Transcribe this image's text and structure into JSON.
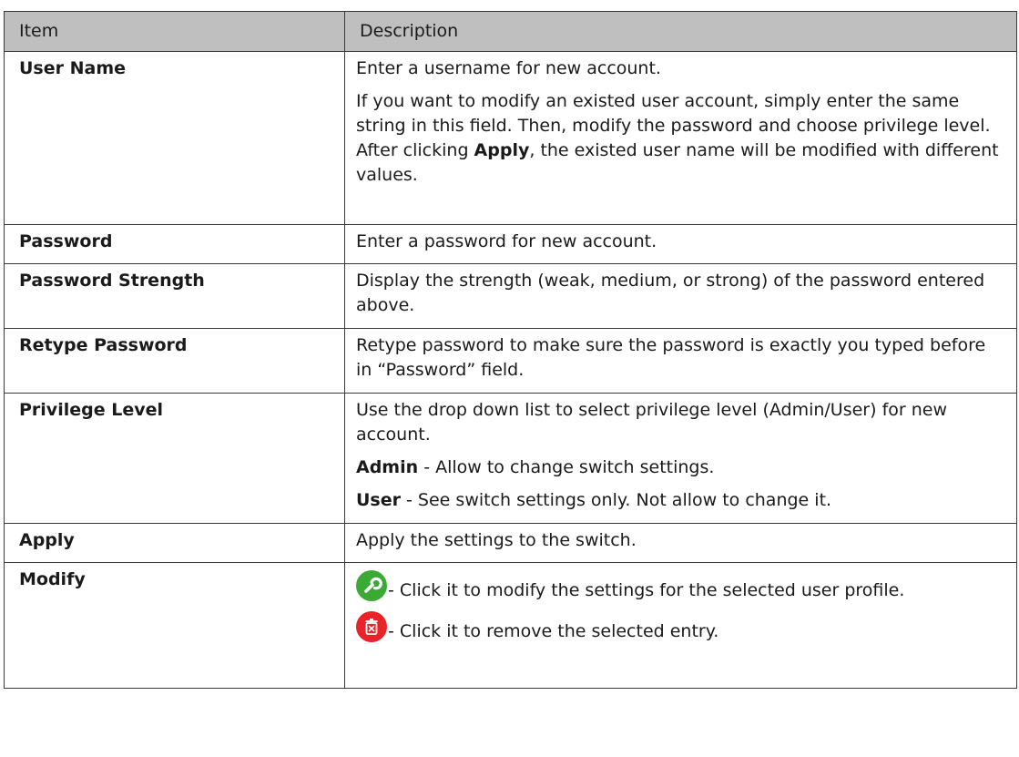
{
  "header": {
    "item": "Item",
    "description": "Description"
  },
  "rows": [
    {
      "item": "User Name",
      "p1": "Enter a username for new account.",
      "p2a": "If you want to modify an existed user account, simply enter the same string in this field. Then, modify the password and choose privilege level. After clicking ",
      "p2b": "Apply",
      "p2c": ", the existed user name will be modified with different values."
    },
    {
      "item": "Password",
      "p1": "Enter a password for new account."
    },
    {
      "item": "Password Strength",
      "p1": "Display the strength (weak, medium, or strong) of the password entered above."
    },
    {
      "item": "Retype Password",
      "p1": "Retype password to make sure the password is exactly you typed before in “Password” field."
    },
    {
      "item": "Privilege Level",
      "p1": "Use the drop down list to select privilege level (Admin/User) for new account.",
      "p2b": "Admin",
      "p2c": " - Allow to change switch settings.",
      "p3b": "User",
      "p3c": " - See switch settings only. Not allow to change it."
    },
    {
      "item": "Apply",
      "p1": "Apply the settings to the switch."
    },
    {
      "item": "Modify",
      "p1": "- Click it to modify the settings for the selected user profile.",
      "p2": "- Click it to remove the selected entry."
    }
  ],
  "icons": {
    "modify_color": "#3aaa35",
    "delete_color": "#e8232a"
  }
}
